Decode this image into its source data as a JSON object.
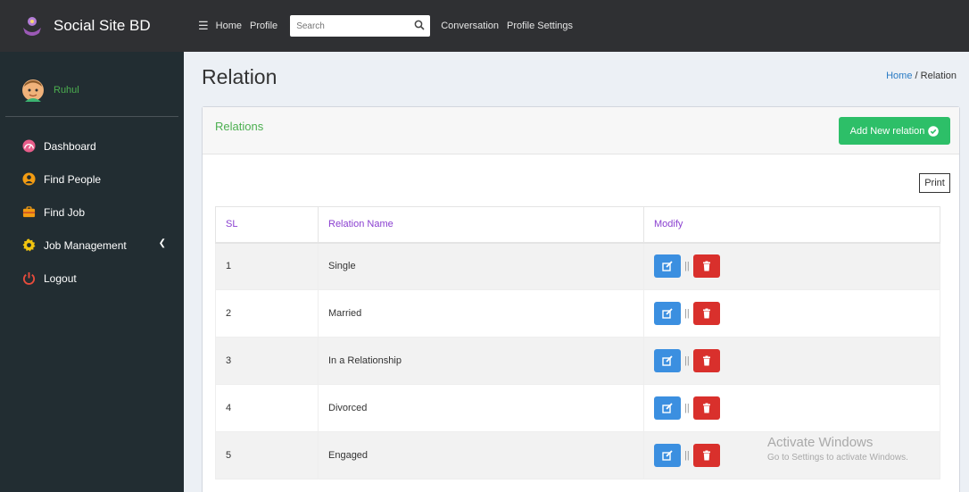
{
  "app": {
    "title": "Social Site BD"
  },
  "user": {
    "name": "Ruhul"
  },
  "sidebar": {
    "items": [
      {
        "label": "Dashboard",
        "icon": "dashboard-icon",
        "color": "#e85d8a"
      },
      {
        "label": "Find People",
        "icon": "user-circle-icon",
        "color": "#f39c12"
      },
      {
        "label": "Find Job",
        "icon": "briefcase-icon",
        "color": "#f39c12"
      },
      {
        "label": "Job Management",
        "icon": "gear-icon",
        "color": "#f1c40f"
      },
      {
        "label": "Logout",
        "icon": "power-icon",
        "color": "#e74c3c"
      }
    ]
  },
  "topbar": {
    "links": [
      "Home",
      "Profile"
    ],
    "search_placeholder": "Search",
    "links_right": [
      "Conversation",
      "Profile Settings"
    ]
  },
  "page": {
    "title": "Relation",
    "breadcrumb": [
      "Home",
      "Relation"
    ]
  },
  "box": {
    "title": "Relations",
    "add_button": "Add New relation",
    "print_button": "Print"
  },
  "table": {
    "headers": [
      "SL",
      "Relation Name",
      "Modify"
    ],
    "rows": [
      {
        "sl": "1",
        "name": "Single"
      },
      {
        "sl": "2",
        "name": "Married"
      },
      {
        "sl": "3",
        "name": "In a Relationship"
      },
      {
        "sl": "4",
        "name": "Divorced"
      },
      {
        "sl": "5",
        "name": "Engaged"
      }
    ],
    "separator": "||"
  },
  "watermark": {
    "title": "Activate Windows",
    "subtitle": "Go to Settings to activate Windows."
  },
  "colors": {
    "accent_green": "#4caf50",
    "add_button": "#2dbf68",
    "edit_button": "#3b8fe0",
    "delete_button": "#d9302c",
    "header_text": "#8a3fd0"
  }
}
